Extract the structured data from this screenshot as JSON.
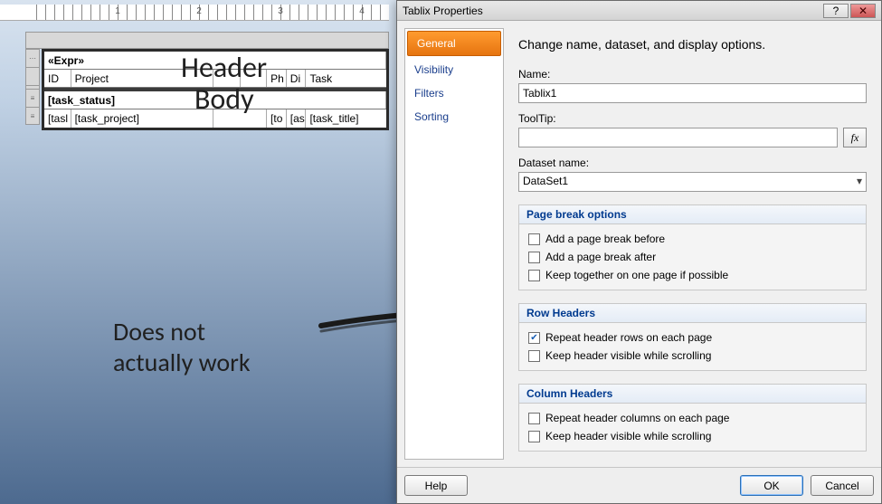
{
  "ruler": {
    "labels": [
      "1",
      "2",
      "3",
      "4"
    ]
  },
  "tablix": {
    "rows": [
      {
        "cells": [
          "«Expr»"
        ],
        "bold": true,
        "widths": [
          390
        ]
      },
      {
        "cells": [
          "ID",
          "Project",
          "",
          "",
          "Ph",
          "Di",
          "Task"
        ],
        "widths": [
          30,
          160,
          30,
          30,
          22,
          22,
          96
        ]
      },
      {
        "cells": [
          "[task_status]"
        ],
        "bold": true,
        "widths": [
          390
        ]
      },
      {
        "cells": [
          "[tasl",
          "[task_project]",
          "",
          "[to",
          "[as",
          "[task_title]"
        ],
        "widths": [
          30,
          160,
          60,
          22,
          22,
          96
        ]
      }
    ]
  },
  "annotations": {
    "header": "Header",
    "body": "Body",
    "note_line1": "Does not",
    "note_line2": "actually work"
  },
  "dialog": {
    "title": "Tablix Properties",
    "nav": [
      "General",
      "Visibility",
      "Filters",
      "Sorting"
    ],
    "nav_selected": 0,
    "headline": "Change name, dataset, and display options.",
    "name_label": "Name:",
    "name_value": "Tablix1",
    "tooltip_label": "ToolTip:",
    "tooltip_value": "",
    "dataset_label": "Dataset name:",
    "dataset_value": "DataSet1",
    "groups": {
      "page_break": {
        "title": "Page break options",
        "items": [
          {
            "label": "Add a page break before",
            "checked": false
          },
          {
            "label": "Add a page break after",
            "checked": false
          },
          {
            "label": "Keep together on one page if possible",
            "checked": false
          }
        ]
      },
      "row_headers": {
        "title": "Row Headers",
        "items": [
          {
            "label": "Repeat header rows on each page",
            "checked": true
          },
          {
            "label": "Keep header visible while scrolling",
            "checked": false
          }
        ]
      },
      "col_headers": {
        "title": "Column Headers",
        "items": [
          {
            "label": "Repeat header columns on each page",
            "checked": false
          },
          {
            "label": "Keep header visible while scrolling",
            "checked": false
          }
        ]
      }
    },
    "buttons": {
      "help": "Help",
      "ok": "OK",
      "cancel": "Cancel"
    },
    "fx": "fx"
  }
}
